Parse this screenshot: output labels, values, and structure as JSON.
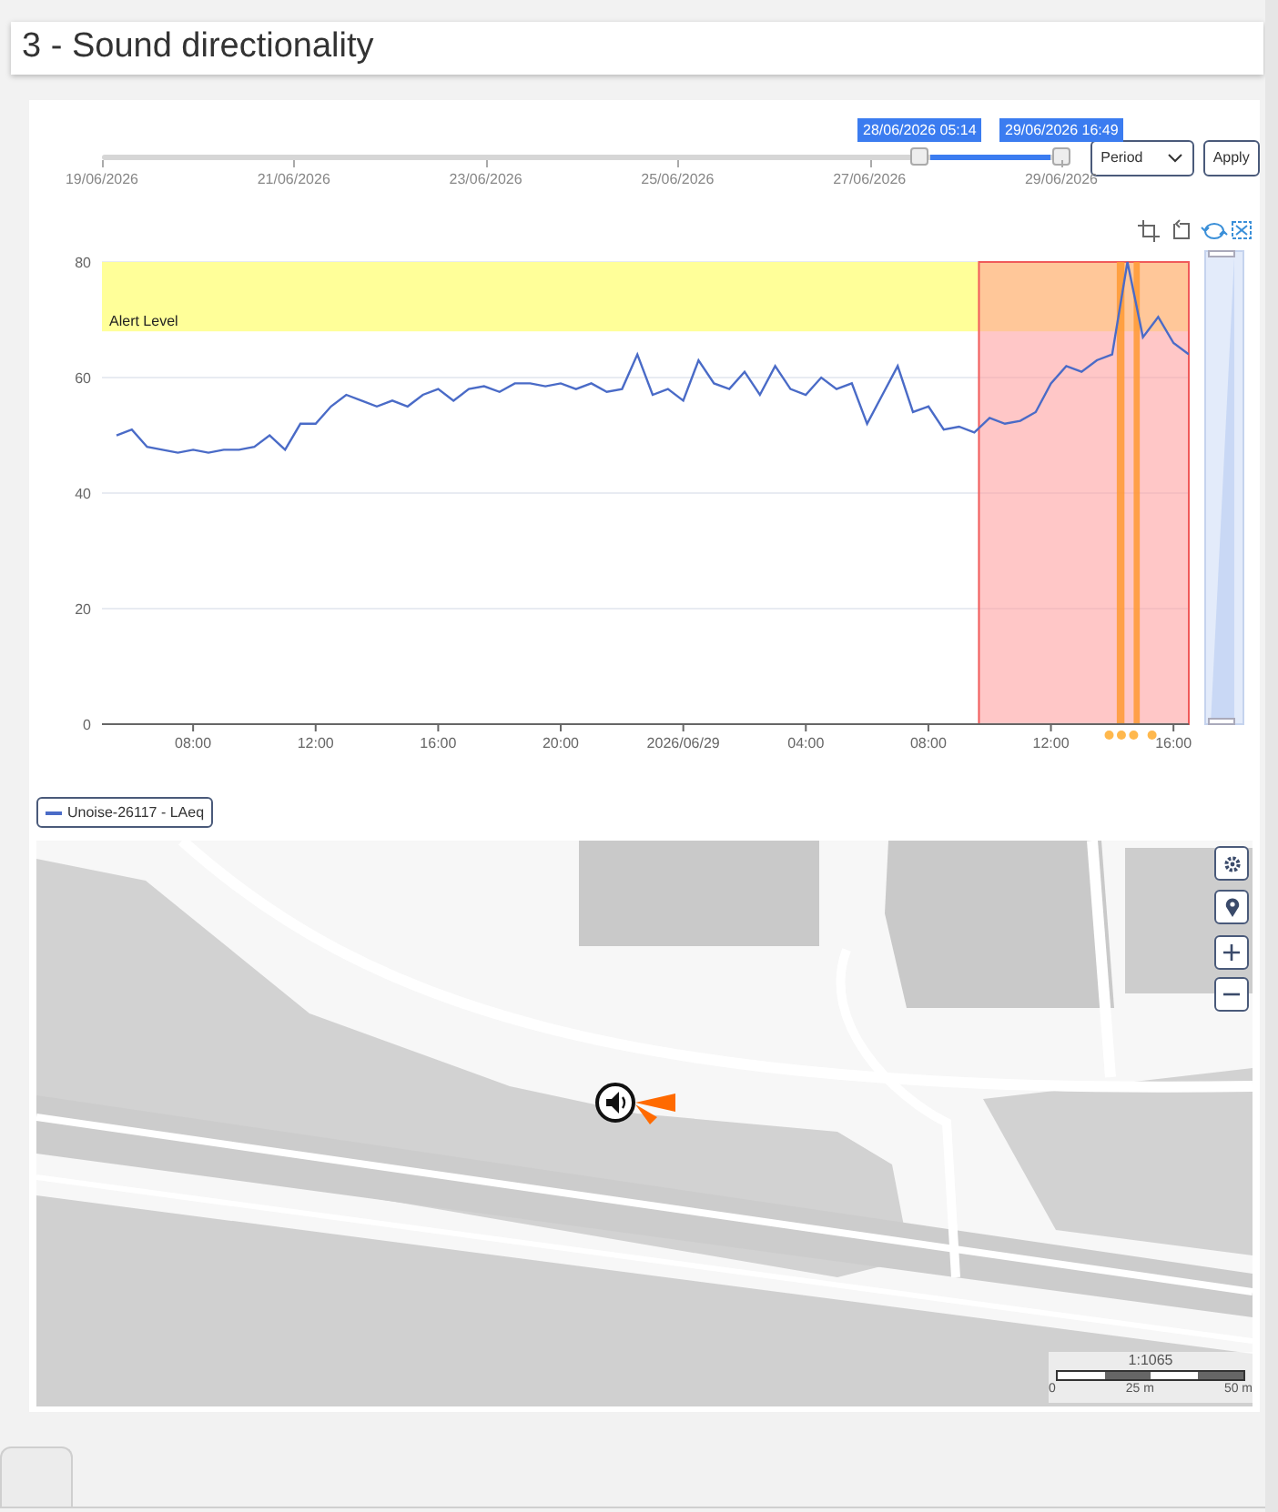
{
  "title": "3 - Sound directionality",
  "range_slider": {
    "ticks": [
      "19/06/2026",
      "21/06/2026",
      "23/06/2026",
      "25/06/2026",
      "27/06/2026",
      "29/06/2026"
    ],
    "handles": [
      {
        "label": "28/06/2026 05:14",
        "level": 0.852
      },
      {
        "label": "29/06/2026 16:49",
        "level": 1.0
      }
    ]
  },
  "period_select": {
    "value": "Period"
  },
  "apply_button": {
    "label": "Apply"
  },
  "chart": {
    "chart_data": {
      "type": "line",
      "ylim": [
        0,
        80
      ],
      "yticks": [
        0,
        20,
        40,
        60,
        80
      ],
      "categories": [
        null,
        null,
        null,
        null,
        null,
        "08:00",
        null,
        null,
        null,
        null,
        null,
        null,
        null,
        "12:00",
        null,
        null,
        null,
        null,
        null,
        null,
        null,
        "16:00",
        null,
        null,
        null,
        null,
        null,
        null,
        null,
        "20:00",
        null,
        null,
        null,
        null,
        null,
        null,
        null,
        "2026/06/29",
        null,
        null,
        null,
        null,
        null,
        null,
        null,
        "04:00",
        null,
        null,
        null,
        null,
        null,
        null,
        null,
        "08:00",
        null,
        null,
        null,
        null,
        null,
        null,
        null,
        "12:00",
        null,
        null,
        null,
        null,
        null,
        null,
        null,
        "16:00",
        null
      ],
      "series": [
        {
          "name": "Unoise-26117 - LAeq",
          "color": "#4a6bc7",
          "values": [
            50,
            51,
            48,
            47.5,
            47,
            47.5,
            47,
            47.5,
            47.5,
            48,
            50,
            47.5,
            52,
            52,
            55,
            57,
            56,
            55,
            56,
            55,
            57,
            58,
            56,
            58,
            58.5,
            57.5,
            59,
            59,
            58.5,
            59,
            58,
            59,
            57.5,
            58,
            64,
            57,
            58,
            56,
            63,
            59,
            58,
            61,
            57,
            62,
            58,
            57,
            60,
            58,
            59,
            52,
            57,
            62,
            54,
            55,
            51,
            51.5,
            50.5,
            53,
            52,
            52.5,
            54,
            59,
            62,
            61,
            63,
            64,
            80,
            67,
            70.5,
            66,
            64
          ]
        }
      ],
      "grid": true,
      "annotations": [
        {
          "text": "Alert Level"
        }
      ],
      "bands": [
        {
          "axis": "y",
          "from": 68,
          "to": 80,
          "color": "#ffff99"
        }
      ]
    },
    "event_markers": [
      {
        "color": "#ffb84d"
      },
      {
        "color": "#ffb84d"
      },
      {
        "color": "#ffb84d"
      },
      {
        "color": "#ffb84d"
      }
    ]
  },
  "map": {
    "kind": "picture",
    "scale": {
      "ratio": "1:1065",
      "labels": [
        "0",
        "25 m",
        "50 m"
      ]
    }
  }
}
